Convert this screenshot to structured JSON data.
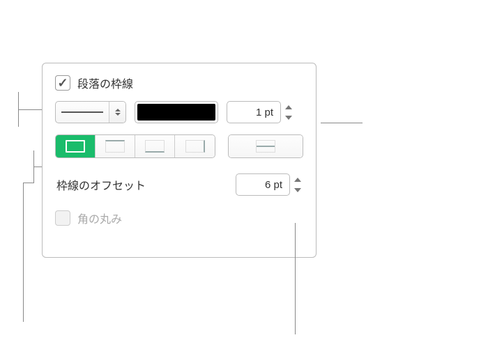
{
  "panel": {
    "paragraph_border_checkbox": {
      "checked": true,
      "label": "段落の枠線"
    },
    "line_style": "solid",
    "line_color": "#000000",
    "line_width": {
      "value": "1 pt"
    },
    "position_buttons": {
      "selected_index": 0,
      "options": [
        "full-border",
        "top-border",
        "bottom-border",
        "right-border"
      ],
      "extra": "center-border"
    },
    "offset": {
      "label": "枠線のオフセット",
      "value": "6 pt"
    },
    "round_corners": {
      "checked": false,
      "label": "角の丸み",
      "enabled": false
    }
  }
}
